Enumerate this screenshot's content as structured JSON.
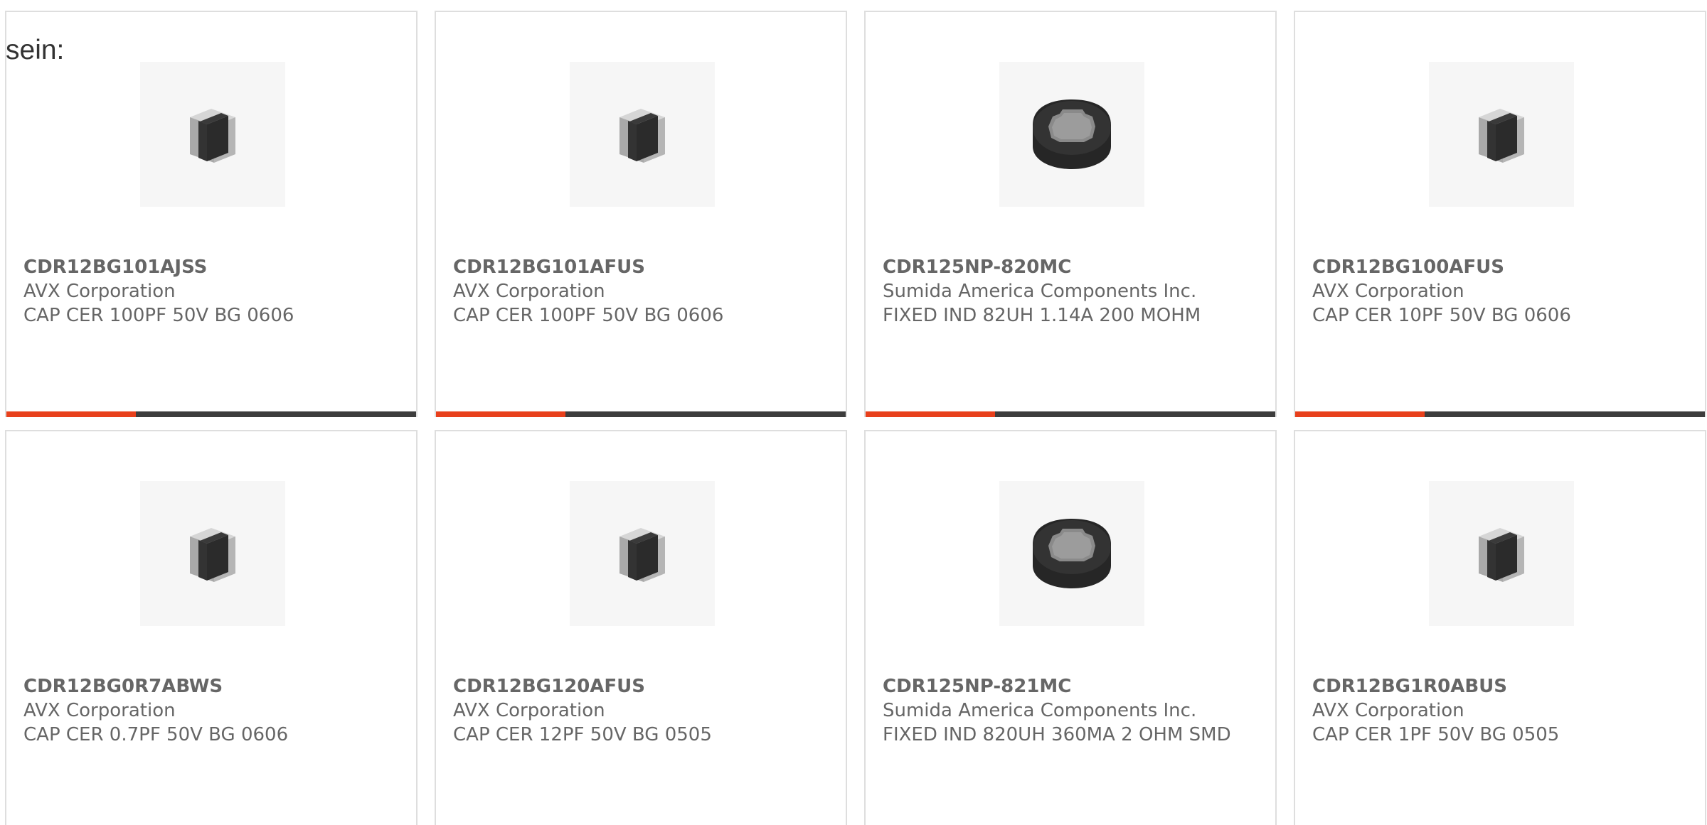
{
  "heading": "sein:",
  "products": [
    {
      "part_number": "CDR12BG101AJSS",
      "manufacturer": "AVX Corporation",
      "description": "CAP CER 100PF 50V BG 0606",
      "icon": "ceramic-capacitor-icon"
    },
    {
      "part_number": "CDR12BG101AFUS",
      "manufacturer": "AVX Corporation",
      "description": "CAP CER 100PF 50V BG 0606",
      "icon": "ceramic-capacitor-icon"
    },
    {
      "part_number": "CDR125NP-820MC",
      "manufacturer": "Sumida America Components Inc.",
      "description": "FIXED IND 82UH 1.14A 200 MOHM",
      "icon": "inductor-icon"
    },
    {
      "part_number": "CDR12BG100AFUS",
      "manufacturer": "AVX Corporation",
      "description": "CAP CER 10PF 50V BG 0606",
      "icon": "ceramic-capacitor-icon"
    },
    {
      "part_number": "CDR12BG0R7ABWS",
      "manufacturer": "AVX Corporation",
      "description": "CAP CER 0.7PF 50V BG 0606",
      "icon": "ceramic-capacitor-icon"
    },
    {
      "part_number": "CDR12BG120AFUS",
      "manufacturer": "AVX Corporation",
      "description": "CAP CER 12PF 50V BG 0505",
      "icon": "ceramic-capacitor-icon"
    },
    {
      "part_number": "CDR125NP-821MC",
      "manufacturer": "Sumida America Components Inc.",
      "description": "FIXED IND 820UH 360MA 2 OHM SMD",
      "icon": "inductor-icon"
    },
    {
      "part_number": "CDR12BG1R0ABUS",
      "manufacturer": "AVX Corporation",
      "description": "CAP CER 1PF 50V BG 0505",
      "icon": "ceramic-capacitor-icon"
    }
  ],
  "colors": {
    "accent": "#e8401c",
    "bar": "#3d3d3d",
    "text": "#666666",
    "border": "#dedede"
  }
}
